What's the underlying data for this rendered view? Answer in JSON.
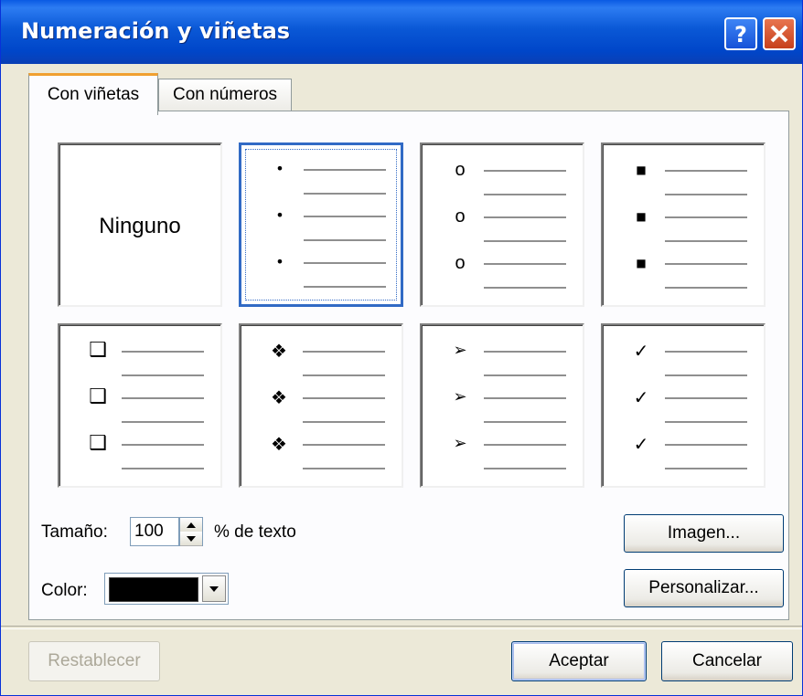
{
  "window": {
    "title": "Numeración y viñetas",
    "help_button": "?",
    "close_button": "X"
  },
  "tabs": [
    {
      "label": "Con viñetas",
      "active": true
    },
    {
      "label": "Con números",
      "active": false
    }
  ],
  "bullet_styles": [
    {
      "label": "Ninguno",
      "bullet": "none",
      "selected": false
    },
    {
      "label": "",
      "bullet": "small-dot",
      "symbol": "•",
      "selected": true
    },
    {
      "label": "",
      "bullet": "hollow-circle",
      "symbol": "o",
      "selected": false
    },
    {
      "label": "",
      "bullet": "filled-square",
      "symbol": "■",
      "selected": false
    },
    {
      "label": "",
      "bullet": "hollow-square",
      "symbol": "❑",
      "selected": false
    },
    {
      "label": "",
      "bullet": "four-diamonds",
      "symbol": "❖",
      "selected": false
    },
    {
      "label": "",
      "bullet": "arrowhead",
      "symbol": "➢",
      "selected": false
    },
    {
      "label": "",
      "bullet": "checkmark",
      "symbol": "✓",
      "selected": false
    }
  ],
  "size": {
    "label": "Tamaño:",
    "value": "100",
    "suffix": "% de texto"
  },
  "color": {
    "label": "Color:",
    "value": "#000000"
  },
  "buttons": {
    "image": "Imagen...",
    "customize": "Personalizar...",
    "reset": "Restablecer",
    "ok": "Aceptar",
    "cancel": "Cancelar"
  }
}
